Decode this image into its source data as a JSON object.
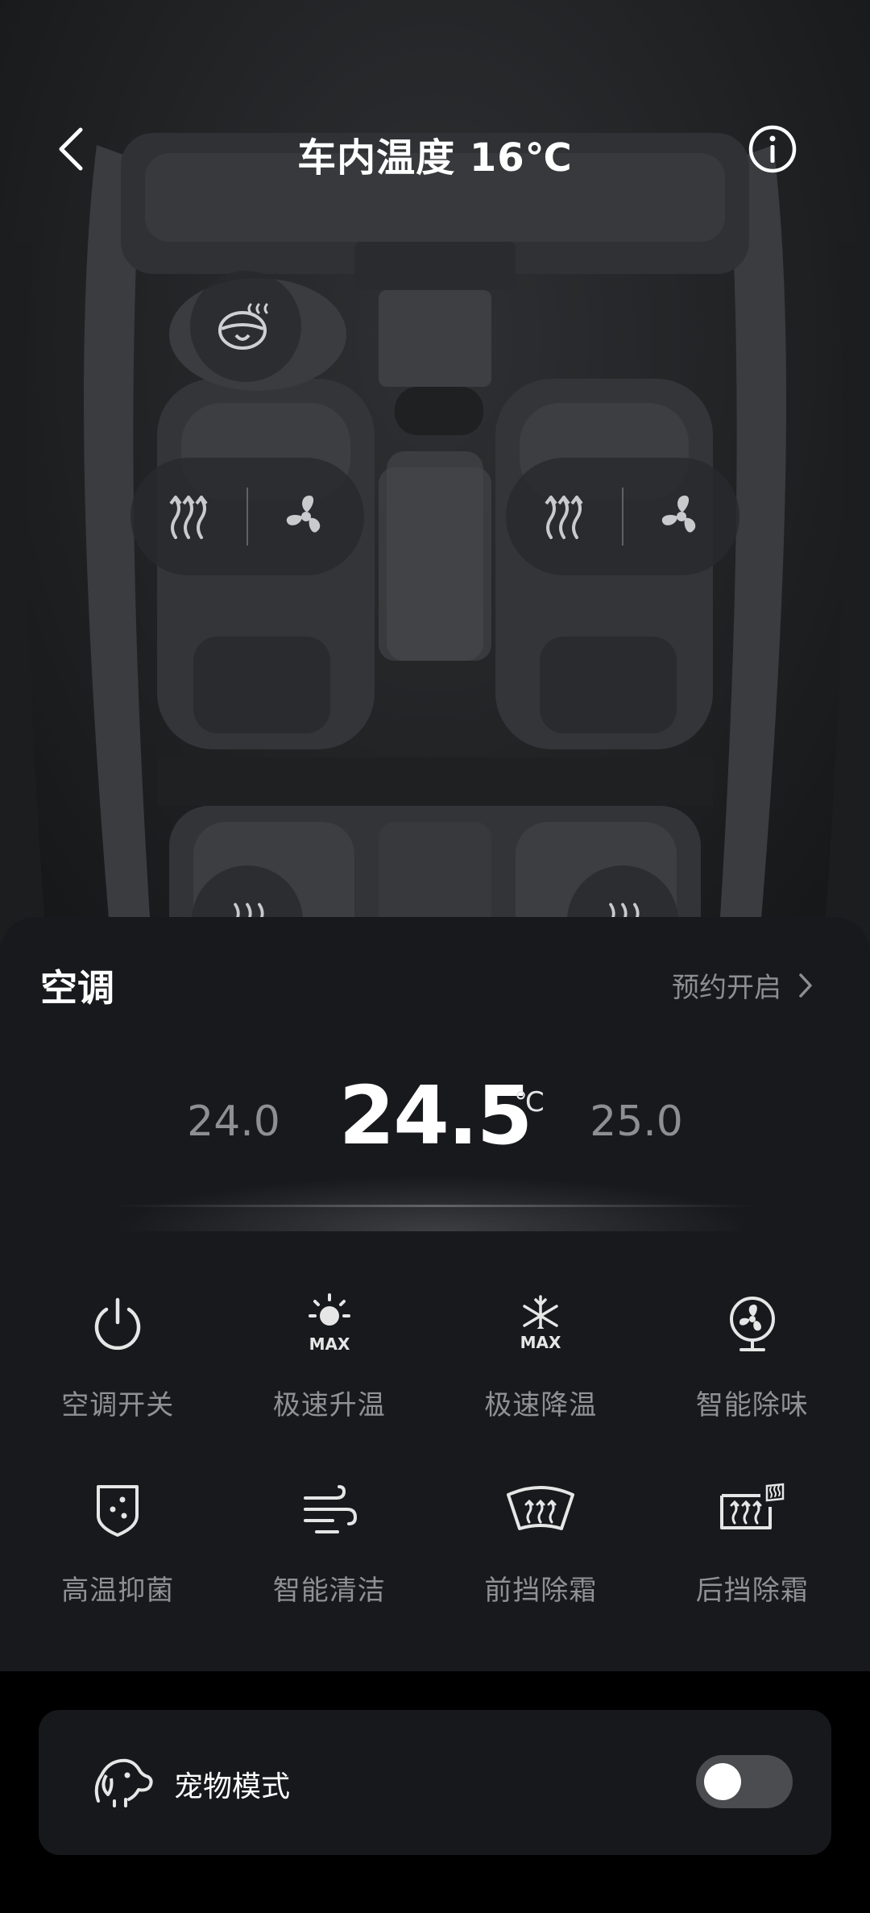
{
  "header": {
    "title": "车内温度 16℃",
    "back_icon": "chevron-left-icon",
    "info_icon": "info-circle-icon"
  },
  "car_scene": {
    "controls": [
      {
        "seat": "steering-wheel",
        "icons": [
          "steering-wheel-heat-icon"
        ]
      },
      {
        "seat": "driver",
        "icons": [
          "seat-heat-icon",
          "seat-fan-icon"
        ]
      },
      {
        "seat": "front-passenger",
        "icons": [
          "seat-heat-icon",
          "seat-fan-icon"
        ]
      },
      {
        "seat": "rear-left",
        "icons": [
          "seat-heat-icon"
        ]
      },
      {
        "seat": "rear-right",
        "icons": [
          "seat-heat-icon"
        ]
      }
    ]
  },
  "ac": {
    "title": "空调",
    "schedule_label": "预约开启",
    "temperature": {
      "prev": "24.0",
      "current": "24.5",
      "unit": "℃",
      "next": "25.0"
    },
    "functions": [
      {
        "label": "空调开关",
        "icon": "power-icon"
      },
      {
        "label": "极速升温",
        "icon": "sun-max-icon",
        "badge": "MAX"
      },
      {
        "label": "极速降温",
        "icon": "snowflake-max-icon",
        "badge": "MAX"
      },
      {
        "label": "智能除味",
        "icon": "fan-icon"
      },
      {
        "label": "高温抑菌",
        "icon": "shield-dots-icon"
      },
      {
        "label": "智能清洁",
        "icon": "wind-icon"
      },
      {
        "label": "前挡除霜",
        "icon": "front-defrost-icon"
      },
      {
        "label": "后挡除霜",
        "icon": "rear-defrost-icon"
      }
    ]
  },
  "pet_mode": {
    "label": "宠物模式",
    "icon": "dog-icon",
    "enabled": false
  },
  "colors": {
    "panel_bg": "#18191c",
    "label_gray": "#8f9195",
    "toggle_off": "#4a4c50"
  }
}
